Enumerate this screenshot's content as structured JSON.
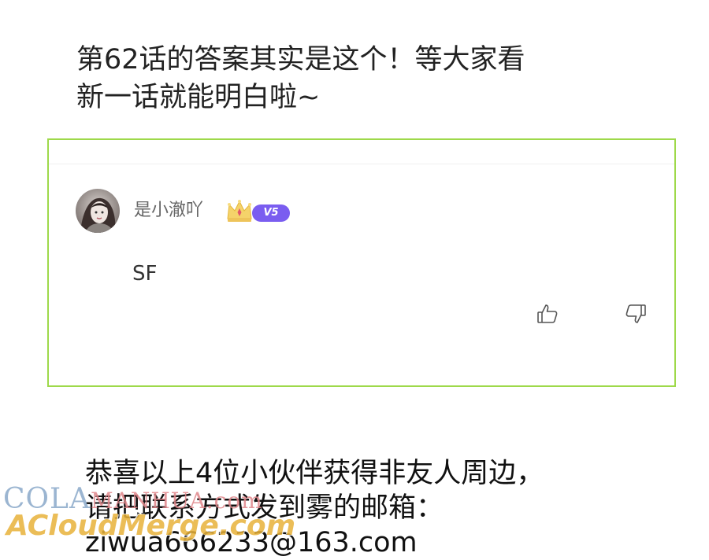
{
  "intro": {
    "line1": "第62话的答案其实是这个！等大家看",
    "line2": "新一话就能明白啦~"
  },
  "comment_card": {
    "username": "是小澈吖",
    "vip_badge": "V5",
    "comment_text": "SF",
    "icons": {
      "avatar": "user-avatar",
      "crown": "crown-icon",
      "like": "thumbs-up-icon",
      "dislike": "thumbs-down-icon"
    },
    "colors": {
      "border": "#9ed94a",
      "vip": "#7a5df0",
      "crown": "#f5d36a"
    }
  },
  "announcement": {
    "line1": "恭喜以上4位小伙伴获得非友人周边，",
    "line2": "请把联系方式发到雾的邮箱：",
    "line3": "ziwua666233@163.com"
  },
  "watermark": {
    "top_left": "COLA",
    "top_right": "MANHUA.com",
    "bottom": "ACloudMerge.com"
  }
}
